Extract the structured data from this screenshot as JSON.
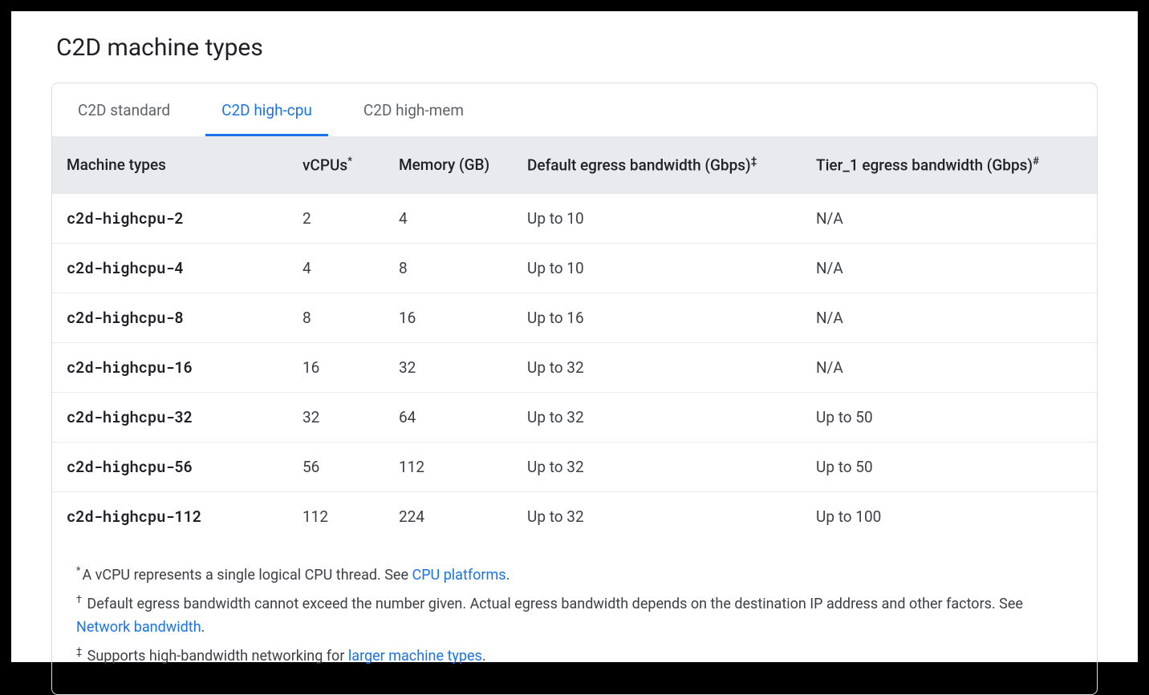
{
  "title": "C2D machine types",
  "tabs": [
    {
      "label": "C2D standard",
      "active": false
    },
    {
      "label": "C2D high-cpu",
      "active": true
    },
    {
      "label": "C2D high-mem",
      "active": false
    }
  ],
  "columns": {
    "machine_types": "Machine types",
    "vcpus": "vCPUs",
    "vcpus_sup": "*",
    "memory": "Memory (GB)",
    "default_egress": "Default egress bandwidth (Gbps)",
    "default_egress_sup": "‡",
    "tier1_egress": "Tier_1 egress bandwidth (Gbps)",
    "tier1_egress_sup": "#"
  },
  "rows": [
    {
      "name": "c2d-highcpu-2",
      "vcpus": "2",
      "memory": "4",
      "egress": "Up to 10",
      "tier1": "N/A"
    },
    {
      "name": "c2d-highcpu-4",
      "vcpus": "4",
      "memory": "8",
      "egress": "Up to 10",
      "tier1": "N/A"
    },
    {
      "name": "c2d-highcpu-8",
      "vcpus": "8",
      "memory": "16",
      "egress": "Up to 16",
      "tier1": "N/A"
    },
    {
      "name": "c2d-highcpu-16",
      "vcpus": "16",
      "memory": "32",
      "egress": "Up to 32",
      "tier1": "N/A"
    },
    {
      "name": "c2d-highcpu-32",
      "vcpus": "32",
      "memory": "64",
      "egress": "Up to 32",
      "tier1": "Up to 50"
    },
    {
      "name": "c2d-highcpu-56",
      "vcpus": "56",
      "memory": "112",
      "egress": "Up to 32",
      "tier1": "Up to 50"
    },
    {
      "name": "c2d-highcpu-112",
      "vcpus": "112",
      "memory": "224",
      "egress": "Up to 32",
      "tier1": "Up to 100"
    }
  ],
  "footnotes": {
    "f1_sup": "*",
    "f1_text_a": "A vCPU represents a single logical CPU thread. See ",
    "f1_link": "CPU platforms",
    "f1_text_b": ".",
    "f2_sup": "†",
    "f2_text_a": " Default egress bandwidth cannot exceed the number given. Actual egress bandwidth depends on the destination IP address and other factors. See ",
    "f2_link": "Network bandwidth",
    "f2_text_b": ".",
    "f3_sup": "‡",
    "f3_text_a": " Supports high-bandwidth networking for ",
    "f3_link": "larger machine types",
    "f3_text_b": "."
  }
}
